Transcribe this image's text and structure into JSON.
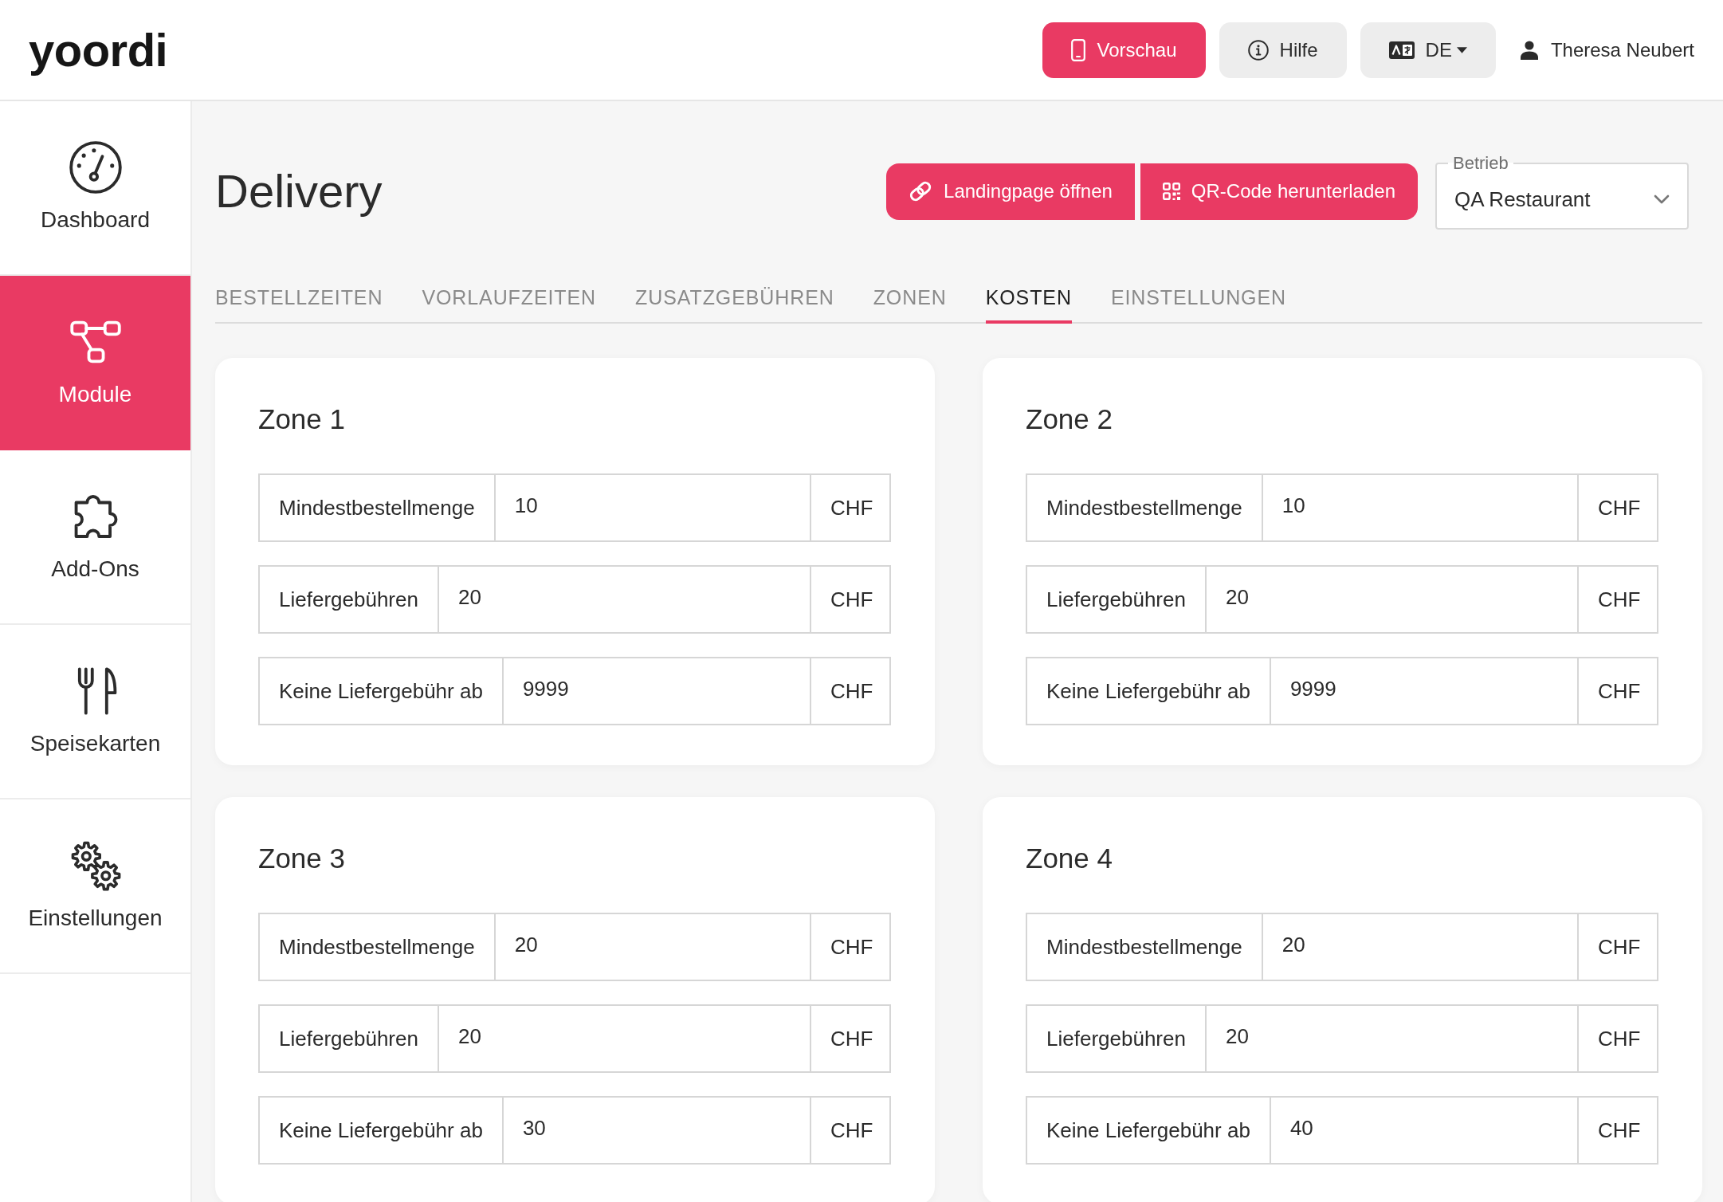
{
  "header": {
    "logo": "yoordi",
    "buttons": [
      {
        "kind": "preview",
        "label": "Vorschau"
      },
      {
        "kind": "help",
        "label": "Hilfe"
      },
      {
        "kind": "language",
        "label": "DE"
      }
    ],
    "user": "Theresa Neubert"
  },
  "sidebar": {
    "items": [
      {
        "kind": "dashboard",
        "label": "Dashboard",
        "selected": false
      },
      {
        "kind": "modules",
        "label": "Module",
        "selected": true
      },
      {
        "kind": "addons",
        "label": "Add-Ons",
        "selected": false
      },
      {
        "kind": "menus",
        "label": "Speisekarten",
        "selected": false
      },
      {
        "kind": "settings",
        "label": "Einstellungen",
        "selected": false
      }
    ]
  },
  "page": {
    "title": "Delivery",
    "actions": [
      {
        "kind": "link",
        "label": "Landingpage öffnen"
      },
      {
        "kind": "qr",
        "label": "QR-Code herunterladen"
      }
    ],
    "business_select": {
      "label": "Betrieb",
      "value": "QA Restaurant"
    },
    "tabs": [
      {
        "label": "BESTELLZEITEN",
        "selected": false
      },
      {
        "label": "VORLAUFZEITEN",
        "selected": false
      },
      {
        "label": "ZUSATZGEBÜHREN",
        "selected": false
      },
      {
        "label": "ZONEN",
        "selected": false
      },
      {
        "label": "KOSTEN",
        "selected": true
      },
      {
        "label": "EINSTELLUNGEN",
        "selected": false
      }
    ],
    "zones": [
      {
        "title": "Zone 1",
        "fields": [
          {
            "label": "Mindestbestellmenge",
            "value": "10",
            "unit": "CHF"
          },
          {
            "label": "Liefergebühren",
            "value": "20",
            "unit": "CHF"
          },
          {
            "label": "Keine Liefergebühr ab",
            "value": "9999",
            "unit": "CHF"
          }
        ]
      },
      {
        "title": "Zone 2",
        "fields": [
          {
            "label": "Mindestbestellmenge",
            "value": "10",
            "unit": "CHF"
          },
          {
            "label": "Liefergebühren",
            "value": "20",
            "unit": "CHF"
          },
          {
            "label": "Keine Liefergebühr ab",
            "value": "9999",
            "unit": "CHF"
          }
        ]
      },
      {
        "title": "Zone 3",
        "fields": [
          {
            "label": "Mindestbestellmenge",
            "value": "20",
            "unit": "CHF"
          },
          {
            "label": "Liefergebühren",
            "value": "20",
            "unit": "CHF"
          },
          {
            "label": "Keine Liefergebühr ab",
            "value": "30",
            "unit": "CHF"
          }
        ]
      },
      {
        "title": "Zone 4",
        "fields": [
          {
            "label": "Mindestbestellmenge",
            "value": "20",
            "unit": "CHF"
          },
          {
            "label": "Liefergebühren",
            "value": "20",
            "unit": "CHF"
          },
          {
            "label": "Keine Liefergebühr ab",
            "value": "40",
            "unit": "CHF"
          }
        ]
      }
    ]
  }
}
